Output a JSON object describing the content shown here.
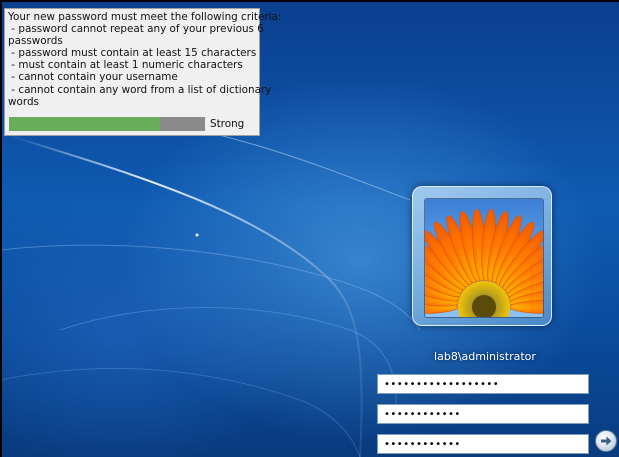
{
  "criteria_popup": {
    "lines": [
      "Your new password must meet the following criteria:",
      " - password cannot repeat any of your previous 6",
      "passwords",
      " - password must contain at least 15 characters",
      " - must contain at least 1 numeric characters",
      " - cannot contain your username",
      " - cannot contain any word from a list of dictionary",
      "words"
    ],
    "strength": {
      "label": "Strong",
      "fill_fraction": 0.77,
      "fill_color": "#68ad5a",
      "track_color": "#8a8a8a"
    }
  },
  "user": {
    "name": "lab8\\administrator",
    "avatar_icon": "orange-gerbera-flower-icon"
  },
  "fields": {
    "current_password": "••••••••••••••••••",
    "new_password": "••••••••••••",
    "confirm_password": "••••••••••••"
  },
  "submit": {
    "icon": "arrow-right-icon"
  },
  "colors": {
    "background": "#0f5bb2",
    "accent": "#68ad5a"
  }
}
